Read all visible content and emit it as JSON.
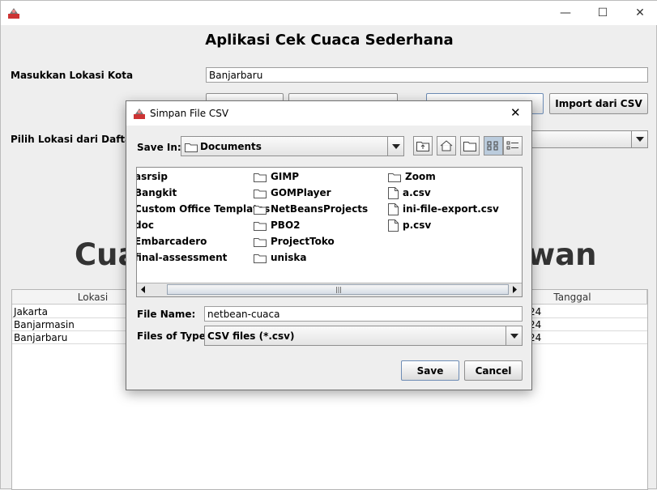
{
  "main": {
    "title": "Aplikasi Cek Cuaca Sederhana",
    "city_label": "Masukkan Lokasi Kota",
    "city_value": "Banjarbaru",
    "favorites_label": "Pilih Lokasi dari Daftar Fa",
    "import_button": "Import dari CSV",
    "heading_left": "Cua",
    "heading_right": "wan",
    "table": {
      "columns": [
        "Lokasi",
        "Tanggal"
      ],
      "rows": [
        {
          "lokasi": "Jakarta",
          "tanggal": "24"
        },
        {
          "lokasi": "Banjarmasin",
          "tanggal": "24"
        },
        {
          "lokasi": "Banjarbaru",
          "tanggal": "24"
        }
      ]
    }
  },
  "window_controls": {
    "minimize": "—",
    "maximize": "☐",
    "close": "✕"
  },
  "dialog": {
    "title": "Simpan File CSV",
    "close": "✕",
    "save_in_label": "Save In:",
    "save_in_value": "Documents",
    "files": [
      {
        "name": "asrsip",
        "type": "folder"
      },
      {
        "name": "Bangkit",
        "type": "folder"
      },
      {
        "name": "Custom Office Templates",
        "type": "folder"
      },
      {
        "name": "doc",
        "type": "folder"
      },
      {
        "name": "Embarcadero",
        "type": "folder"
      },
      {
        "name": "final-assessment",
        "type": "folder"
      },
      {
        "name": "GIMP",
        "type": "folder"
      },
      {
        "name": "GOMPlayer",
        "type": "folder"
      },
      {
        "name": "NetBeansProjects",
        "type": "folder"
      },
      {
        "name": "PBO2",
        "type": "folder"
      },
      {
        "name": "ProjectToko",
        "type": "folder"
      },
      {
        "name": "uniska",
        "type": "folder"
      },
      {
        "name": "Zoom",
        "type": "folder"
      },
      {
        "name": "a.csv",
        "type": "file"
      },
      {
        "name": "ini-file-export.csv",
        "type": "file"
      },
      {
        "name": "p.csv",
        "type": "file"
      }
    ],
    "file_name_label": "File Name:",
    "file_name_value": "netbean-cuaca",
    "file_type_label": "Files of Type:",
    "file_type_value": "CSV files (*.csv)",
    "save_button": "Save",
    "cancel_button": "Cancel"
  }
}
